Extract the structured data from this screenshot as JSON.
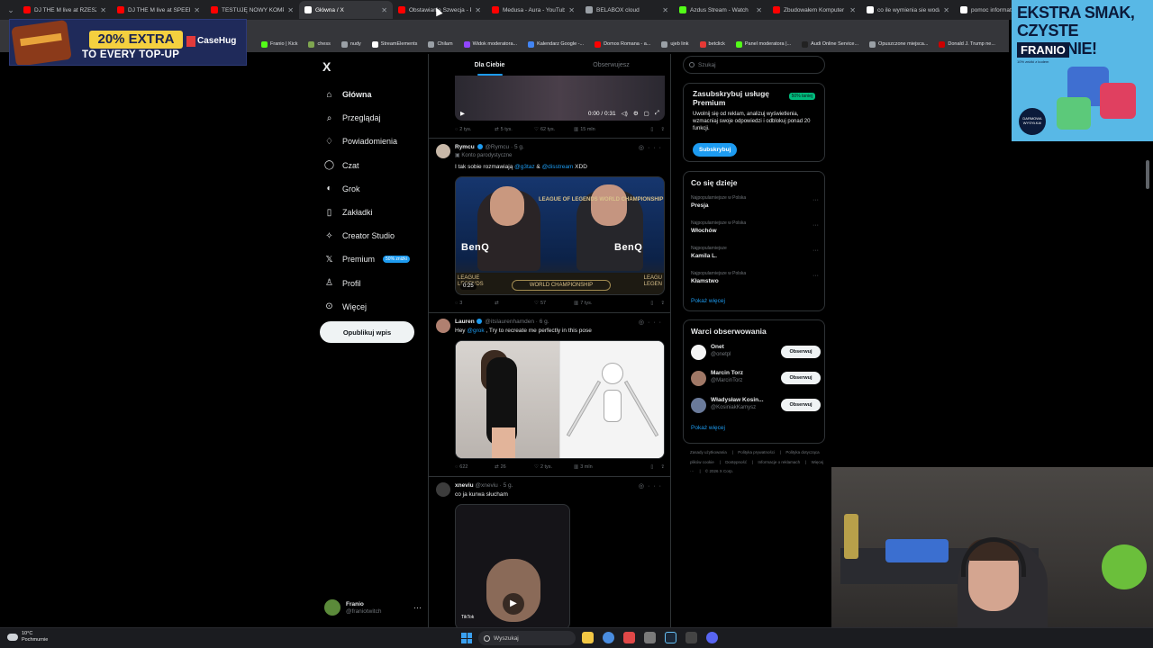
{
  "browser": {
    "tabs": [
      {
        "title": "DJ THE M live at RZESZOW",
        "color": "#ff0000",
        "active": false
      },
      {
        "title": "DJ THE M live at SPEEDLAND",
        "color": "#ff0000",
        "active": false
      },
      {
        "title": "TESTUJĘ NOWY KOMPUTER",
        "color": "#ff0000",
        "active": false
      },
      {
        "title": "Główna / X",
        "color": "#ffffff",
        "active": true
      },
      {
        "title": "Obstawianie Szwecja - Polska",
        "color": "#ff0000",
        "active": false
      },
      {
        "title": "Medusa - Aura - YouTube",
        "color": "#ff0000",
        "active": false
      },
      {
        "title": "BELABOX cloud",
        "color": "#9aa0a6",
        "active": false
      },
      {
        "title": "Azdus Stream - Watch",
        "color": "#53fc18",
        "active": false
      },
      {
        "title": "Zbudowałem Komputer",
        "color": "#ff0000",
        "active": false
      },
      {
        "title": "co ile wymienia sie woda",
        "color": "#ffffff",
        "active": false
      },
      {
        "title": "pomoc informatyczna",
        "color": "#ffffff",
        "active": false
      }
    ],
    "bookmarks": [
      {
        "label": "Franio | Kick",
        "color": "#53fc18"
      },
      {
        "label": "chess",
        "color": "#7fa650"
      },
      {
        "label": "nudy",
        "color": "#9aa0a6"
      },
      {
        "label": "StreamElements",
        "color": "#ffffff"
      },
      {
        "label": "Chilam",
        "color": "#9aa0a6"
      },
      {
        "label": "Widok moderatora...",
        "color": "#9146ff"
      },
      {
        "label": "Kalendarz Google -...",
        "color": "#4285f4"
      },
      {
        "label": "Domos Romana - a...",
        "color": "#ff0000"
      },
      {
        "label": "ujeb link",
        "color": "#9aa0a6"
      },
      {
        "label": "betclick",
        "color": "#e53935"
      },
      {
        "label": "Panel moderatora |...",
        "color": "#53fc18"
      },
      {
        "label": "Audi Online Service...",
        "color": "#222222"
      },
      {
        "label": "Opuszczone miejsca...",
        "color": "#9aa0a6"
      },
      {
        "label": "Donald J. Trump ne...",
        "color": "#cc0000"
      }
    ]
  },
  "ads": {
    "casehug": {
      "big": "20% EXTRA",
      "sub": "TO EVERY TOP-UP",
      "brand": "CaseHug"
    },
    "franio": {
      "headline": "EKSTRA SMAK, CZYSTE SUMIENIE!",
      "brand": "FRANIO",
      "small": "10% zniżki z kodem",
      "badge": "DARMOWA WYSYŁKA!"
    }
  },
  "x": {
    "logo": "X",
    "nav": [
      {
        "label": "Główna",
        "icon": "home-icon",
        "glyph": "⌂",
        "active": true
      },
      {
        "label": "Przeglądaj",
        "icon": "search-icon",
        "glyph": "⌕",
        "active": false
      },
      {
        "label": "Powiadomienia",
        "icon": "bell-icon",
        "glyph": "♢",
        "active": false
      },
      {
        "label": "Czat",
        "icon": "chat-icon",
        "glyph": "◯",
        "active": false
      },
      {
        "label": "Grok",
        "icon": "grok-icon",
        "glyph": "◐",
        "active": false
      },
      {
        "label": "Zakładki",
        "icon": "bookmark-icon",
        "glyph": "▯",
        "active": false
      },
      {
        "label": "Creator Studio",
        "icon": "creator-studio-icon",
        "glyph": "✧",
        "active": false
      },
      {
        "label": "Premium",
        "icon": "premium-icon",
        "glyph": "𝕏",
        "active": false,
        "pill": "50% zniżki"
      },
      {
        "label": "Profil",
        "icon": "profile-icon",
        "glyph": "♙",
        "active": false
      },
      {
        "label": "Więcej",
        "icon": "more-icon",
        "glyph": "⊙",
        "active": false
      }
    ],
    "post_button": "Opublikuj wpis",
    "me": {
      "name": "Franio",
      "handle": "@franiotwitch"
    },
    "feed_tabs": [
      "Dla Ciebie",
      "Obserwujesz"
    ],
    "video1": {
      "time": "0:00 / 0:31",
      "actions": {
        "replies": "2 tys.",
        "reposts": "5 tys.",
        "likes": "62 tys.",
        "views": "15 mln"
      }
    },
    "tweets": [
      {
        "name": "Rymcu",
        "handle": "@Rymcu",
        "time": "5 g.",
        "sub": "Konto parodystyczne",
        "text_before": "I tak sobie rozmawiają ",
        "mention1": "@g3taz",
        "text_mid": " & ",
        "mention2": "@disstream",
        "text_after": " XDD",
        "media_labels": {
          "benq_left": "BenQ",
          "benq_right": "BenQ",
          "event": "LEAGUE OF LEGENDS WORLD CHAMPIONSHIP",
          "bar": "WORLD CHAMPIONSHIP",
          "left_edge": "LEAGUE LEGENDS",
          "right_edge": "LEAGU LEGEN",
          "duration": "0:25"
        },
        "actions": {
          "replies": "3",
          "reposts": "",
          "likes": "57",
          "views": "7 tys."
        }
      },
      {
        "name": "Lauren",
        "handle": "@itslaurenhamden",
        "time": "6 g.",
        "text_before": "Hey ",
        "mention1": "@grok",
        "text_after": " , Try to recreate me perfectly in this pose",
        "actions": {
          "replies": "622",
          "reposts": "26",
          "likes": "2 tys.",
          "views": "3 mln"
        }
      },
      {
        "name": "xneviu",
        "handle": "@xneviu",
        "time": "5 g.",
        "text_before": "co ja kurwa słucham",
        "media_labels": {
          "tiktok": "TikTok"
        }
      }
    ],
    "search_placeholder": "Szukaj",
    "premium": {
      "title": "Zasubskrybuj usługę Premium",
      "pill": "50% taniej",
      "desc": "Uwolnij się od reklam, analizuj wyświetlenia, wzmacniaj swoje odpowiedzi i odblokuj ponad 20 funkcji.",
      "button": "Subskrybuj"
    },
    "trends": {
      "title": "Co się dzieje",
      "items": [
        {
          "context": "Najpopularniejsze w Polska",
          "name": "Presja"
        },
        {
          "context": "Najpopularniejsze w Polska",
          "name": "Włochów"
        },
        {
          "context": "Najpopularniejsze",
          "name": "Kamila L."
        },
        {
          "context": "Najpopularniejsze w Polska",
          "name": "Kłamstwo"
        }
      ],
      "more": "Pokaż więcej"
    },
    "who_to_follow": {
      "title": "Warci obserwowania",
      "users": [
        {
          "name": "Onet",
          "handle": "@onetpl",
          "button": "Obserwuj",
          "color": "#f5f5f5"
        },
        {
          "name": "Marcin Torz",
          "handle": "@MarcinTorz",
          "button": "Obserwuj",
          "color": "#a07866"
        },
        {
          "name": "Władysław Kosin...",
          "handle": "@KosiniakKamysz",
          "button": "Obserwuj",
          "color": "#6a7a9a"
        }
      ],
      "more": "Pokaż więcej"
    },
    "footer": [
      "Zasady użytkowania",
      "Polityka prywatności",
      "Polityka dotycząca plików cookie",
      "Dostępność",
      "Informacje o reklamach",
      "Więcej ···",
      "© 2026 X Corp."
    ]
  },
  "taskbar": {
    "weather_temp": "10°C",
    "weather_desc": "Pochmurnie",
    "search_placeholder": "Wyszukaj"
  }
}
